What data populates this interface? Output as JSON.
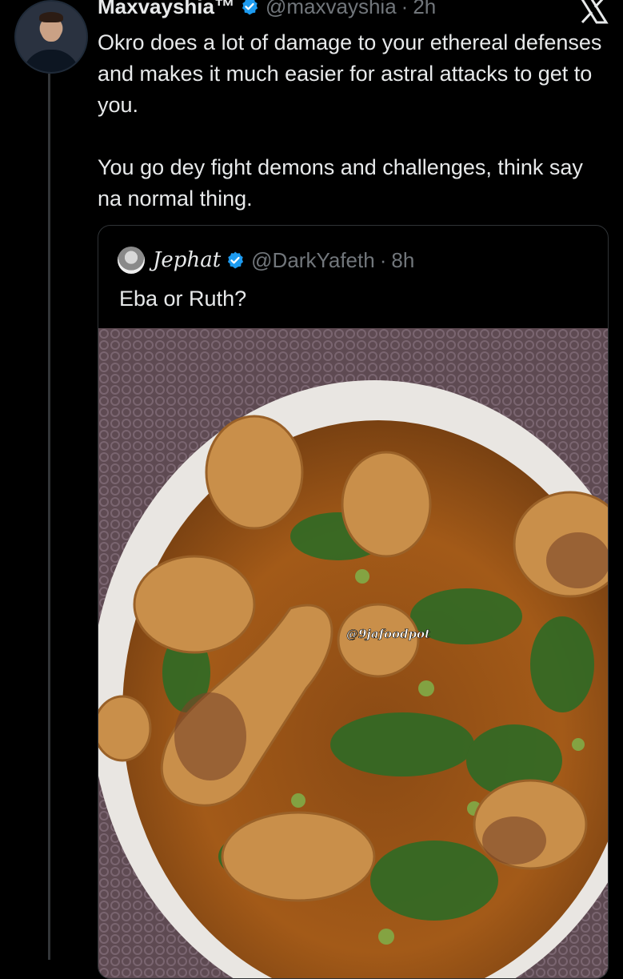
{
  "tweet": {
    "author_name": "Maxvayshia™",
    "verified": true,
    "handle": "@maxvayshia",
    "separator": "·",
    "time": "2h",
    "paragraphs": [
      "Okro does a lot of damage to your ethereal defenses and makes it much easier for astral attacks to get to you.",
      "You go dey fight demons and challenges, think say na normal thing."
    ],
    "close_icon": "x-logo-icon"
  },
  "quoted_tweet": {
    "author_name": "Jephat",
    "verified": true,
    "handle": "@DarkYafeth",
    "separator": "·",
    "time": "8h",
    "text": "Eba or Ruth?",
    "image_watermark": "@9jafoodpot"
  },
  "colors": {
    "background": "#000000",
    "text": "#e7e9ea",
    "muted": "#71767b",
    "verified": "#1d9bf0",
    "border": "#2f3336"
  }
}
